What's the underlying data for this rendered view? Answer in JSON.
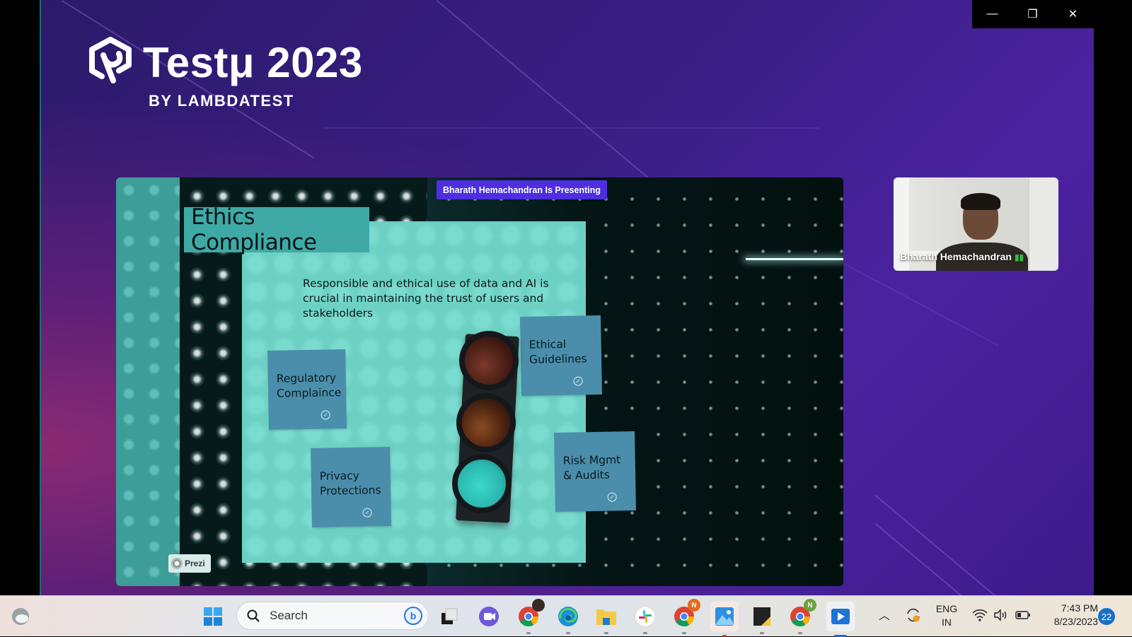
{
  "window": {
    "controls": {
      "minimize_icon": "—",
      "restore_icon": "❐",
      "close_icon": "✕"
    }
  },
  "event": {
    "title": "Testμ 2023",
    "subtitle": "BY LAMBDATEST",
    "logo_icon": "testmu-logo-icon"
  },
  "presentation": {
    "presenting_label": "Bharath Hemachandran Is Presenting",
    "slide": {
      "title": "Ethics Compliance",
      "subtitle": "Responsible and ethical use of data and AI is crucial in maintaining the trust of users and stakeholders",
      "notes": [
        {
          "label": "Regulatory Complaince"
        },
        {
          "label": "Ethical Guidelines"
        },
        {
          "label": "Privacy Protections"
        },
        {
          "label": "Risk Mgmt & Audits"
        }
      ],
      "traffic_light": {
        "lamps": [
          "red",
          "amber",
          "green"
        ],
        "lit": "green"
      }
    },
    "watermark": "Prezi"
  },
  "participant": {
    "name": "Bharath Hemachandran",
    "mic_icon": "mic-on-icon"
  },
  "taskbar": {
    "search_placeholder": "Search",
    "apps": [
      {
        "name": "weather-widget",
        "icon": "weather-icon"
      },
      {
        "name": "start",
        "icon": "windows-start-icon"
      },
      {
        "name": "bing-chat",
        "icon": "bing-icon"
      },
      {
        "name": "task-view",
        "icon": "task-view-icon"
      },
      {
        "name": "teams-chat",
        "icon": "meet-icon"
      },
      {
        "name": "chrome-profile-1",
        "icon": "chrome-icon"
      },
      {
        "name": "edge",
        "icon": "edge-icon"
      },
      {
        "name": "file-explorer",
        "icon": "folder-icon"
      },
      {
        "name": "slack",
        "icon": "slack-icon"
      },
      {
        "name": "chrome-profile-N-orange",
        "icon": "chrome-icon",
        "badge": "N"
      },
      {
        "name": "photos",
        "icon": "photos-icon"
      },
      {
        "name": "sticky-notes",
        "icon": "sticky-notes-icon"
      },
      {
        "name": "chrome-profile-N-green",
        "icon": "chrome-icon",
        "badge": "N"
      },
      {
        "name": "media-player",
        "icon": "media-player-icon"
      }
    ],
    "tray": {
      "language_primary": "ENG",
      "language_secondary": "IN",
      "time": "7:43 PM",
      "date": "8/23/2023",
      "notification_count": "22"
    }
  }
}
